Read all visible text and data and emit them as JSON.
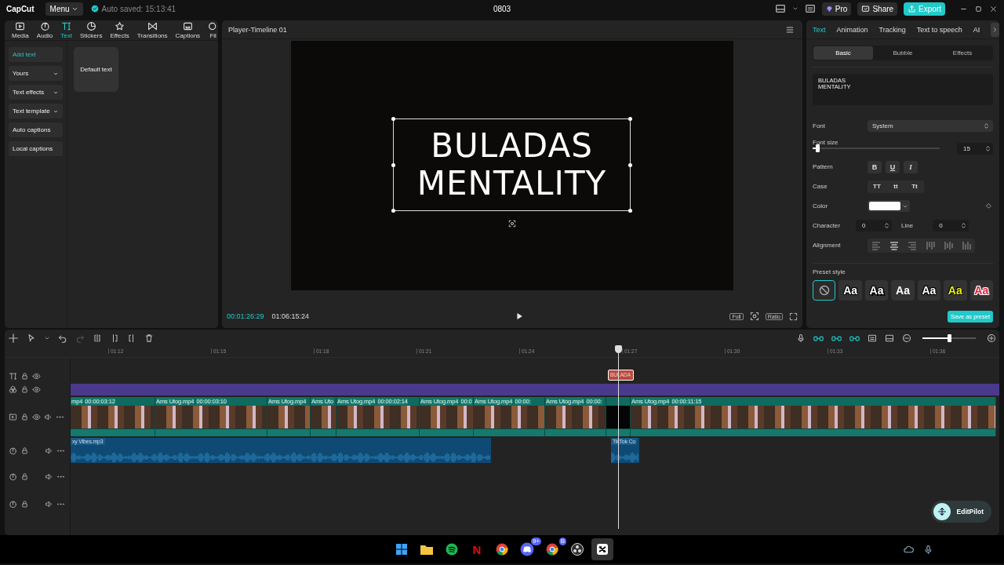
{
  "title_bar": {
    "logo": "CapCut",
    "menu": "Menu",
    "autosave": "Auto saved: 15:13:41",
    "project": "0803",
    "pro": "Pro",
    "share": "Share",
    "export": "Export"
  },
  "tool_tabs": [
    {
      "kind": "media",
      "label": "Media",
      "selected": false
    },
    {
      "kind": "audio",
      "label": "Audio",
      "selected": false
    },
    {
      "kind": "text",
      "label": "Text",
      "selected": true
    },
    {
      "kind": "stickers",
      "label": "Stickers",
      "selected": false
    },
    {
      "kind": "effects",
      "label": "Effects",
      "selected": false
    },
    {
      "kind": "transitions",
      "label": "Transitions",
      "selected": false
    },
    {
      "kind": "captions",
      "label": "Captions",
      "selected": false
    },
    {
      "kind": "filters",
      "label": "Fil",
      "selected": false
    }
  ],
  "text_nav": [
    {
      "label": "Add text",
      "selected": true,
      "dropdown": false
    },
    {
      "label": "Yours",
      "selected": false,
      "dropdown": true
    },
    {
      "label": "Text effects",
      "selected": false,
      "dropdown": true
    },
    {
      "label": "Text template",
      "selected": false,
      "dropdown": true
    },
    {
      "label": "Auto captions",
      "selected": false,
      "dropdown": false
    },
    {
      "label": "Local captions",
      "selected": false,
      "dropdown": false
    }
  ],
  "text_cards": [
    "Default text"
  ],
  "player": {
    "title": "Player-Timeline 01",
    "overlay_text": "BULADAS\nMENTALITY",
    "current_time": "00:01:26:29",
    "total_time": "01:06:15:24",
    "full": "Full",
    "ratio": "Ratio"
  },
  "inspector": {
    "tabs": [
      {
        "label": "Text",
        "selected": true
      },
      {
        "label": "Animation",
        "selected": false
      },
      {
        "label": "Tracking",
        "selected": false
      },
      {
        "label": "Text to speech",
        "selected": false
      },
      {
        "label": "AI",
        "selected": false
      }
    ],
    "subtabs": [
      {
        "label": "Basic",
        "selected": true
      },
      {
        "label": "Bubble",
        "selected": false
      },
      {
        "label": "Effects",
        "selected": false
      }
    ],
    "content": "BULADAS\nMENTALITY",
    "font": {
      "label": "Font",
      "value": "System"
    },
    "font_size": {
      "label": "Font size",
      "level": 0.04,
      "value": "15"
    },
    "pattern": {
      "label": "Pattern",
      "buttons": [
        "B",
        "U",
        "I"
      ]
    },
    "case": {
      "label": "Case",
      "buttons": [
        "TT",
        "tt",
        "Tt"
      ]
    },
    "color": {
      "label": "Color"
    },
    "character": {
      "label": "Character",
      "value": "0"
    },
    "line": {
      "label": "Line",
      "value": "0"
    },
    "alignment": {
      "label": "Alignment",
      "options": [
        {
          "kind": "left",
          "selected": false
        },
        {
          "kind": "center",
          "selected": true
        },
        {
          "kind": "right",
          "selected": false
        },
        {
          "kind": "top",
          "selected": false
        },
        {
          "kind": "middle",
          "selected": false
        },
        {
          "kind": "bottom",
          "selected": false
        }
      ]
    },
    "preset_style": {
      "label": "Preset style",
      "presets": [
        {
          "kind": "none",
          "selected": true
        },
        {
          "kind": "shadow",
          "label": "Aa",
          "selected": false
        },
        {
          "kind": "outline",
          "label": "Aa",
          "selected": false
        },
        {
          "kind": "plain",
          "label": "Aa",
          "selected": false
        },
        {
          "kind": "shadow",
          "label": "Aa",
          "selected": false
        },
        {
          "kind": "yellow",
          "label": "Aa",
          "selected": false
        },
        {
          "kind": "red",
          "label": "Aa",
          "selected": false
        }
      ]
    },
    "save_preset": "Save as preset"
  },
  "timeline": {
    "ruler": [
      "01:12",
      "01:15",
      "01:18",
      "01:21",
      "01:24",
      "01:27",
      "01:30",
      "01:33",
      "01:36"
    ],
    "zoom": {
      "level": 0.5
    },
    "tracks": [
      {
        "kind": "text",
        "clips": [
          {
            "label": "BULADA"
          }
        ]
      },
      {
        "kind": "effect"
      },
      {
        "kind": "video",
        "clips": [
          {
            "kind": "footage",
            "name": "mp4",
            "duration": "00:00:03:12"
          },
          {
            "kind": "footage",
            "name": "Ams Utog.mp4",
            "duration": "00:00:03:10"
          },
          {
            "kind": "footage",
            "name": "Ams Utog.mp4"
          },
          {
            "kind": "footage",
            "name": "Ams Uto"
          },
          {
            "kind": "footage",
            "name": "Ams Utog.mp4",
            "duration": "00:00:02:14"
          },
          {
            "kind": "footage",
            "name": "Ams Utog.mp4",
            "duration": "00:0"
          },
          {
            "kind": "footage",
            "name": "Ams Utog.mp4",
            "duration": "00:00:"
          },
          {
            "kind": "footage",
            "name": "Ams Utog.mp4",
            "duration": "00:00:"
          },
          {
            "kind": "blank"
          },
          {
            "kind": "footage",
            "name": "Ams Utog.mp4",
            "duration": "00:00:11:15"
          }
        ]
      },
      {
        "kind": "audio",
        "clips": [
          {
            "name": "xy Vibes.mp3"
          },
          {
            "name": "TikTok Co"
          }
        ]
      },
      {
        "kind": "audio"
      },
      {
        "kind": "audio"
      }
    ]
  },
  "assistant": {
    "label": "EditPilot"
  },
  "taskbar": {
    "apps": [
      {
        "kind": "windows",
        "selected": false
      },
      {
        "kind": "folder",
        "selected": false
      },
      {
        "kind": "spotify",
        "selected": false
      },
      {
        "kind": "netflix",
        "glyph": "N",
        "selected": false
      },
      {
        "kind": "chrome",
        "selected": false
      },
      {
        "kind": "discord",
        "badge": "9+",
        "selected": false
      },
      {
        "kind": "chrome",
        "badge": "B",
        "selected": false
      },
      {
        "kind": "obs",
        "selected": false
      },
      {
        "kind": "capcut",
        "selected": true
      }
    ]
  }
}
